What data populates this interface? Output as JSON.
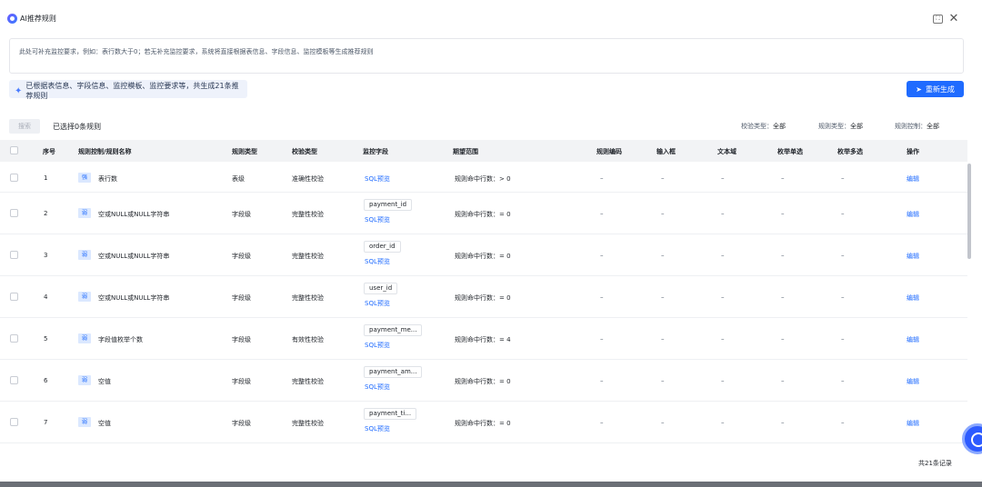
{
  "header": {
    "title": "AI推荐规则",
    "fullscreen_label": "⛶",
    "close_label": "✕"
  },
  "requirement": {
    "placeholder": "此处可补充监控要求，例如：表行数大于0；若无补充监控要求，系统将直接根据表信息、字段信息、监控模板等生成推荐规则"
  },
  "info": {
    "icon": "sparkle-icon",
    "text": "已根据表信息、字段信息、监控模板、监控要求等，共生成21条推荐规则"
  },
  "regen": {
    "label": "重新生成",
    "icon": "send-icon"
  },
  "toolbar": {
    "search_label": "搜索",
    "selected": "已选择0条规则",
    "filters": [
      {
        "label": "校验类型：",
        "value": "全部"
      },
      {
        "label": "规则类型：",
        "value": "全部"
      },
      {
        "label": "规则控制：",
        "value": "全部"
      }
    ]
  },
  "columns": [
    "序号",
    "规则控制/规则名称",
    "规则类型",
    "校验类型",
    "监控字段",
    "期望范围",
    "规则编码",
    "输入框",
    "文本域",
    "枚举单选",
    "枚举多选",
    "操作"
  ],
  "rows": [
    {
      "idx": "1",
      "badge": "强",
      "name": "表行数",
      "rule_type": "表级",
      "check_type": "准确性校验",
      "field": "",
      "sql": "SQL预览",
      "expect": "规则命中行数：> 0",
      "code": "–",
      "input": "–",
      "text": "–",
      "single": "–",
      "multi": "–",
      "op": "编辑"
    },
    {
      "idx": "2",
      "badge": "弱",
      "name": "空或NULL或NULL字符串",
      "rule_type": "字段级",
      "check_type": "完整性校验",
      "field": "payment_id",
      "sql": "SQL预览",
      "expect": "规则命中行数：= 0",
      "code": "–",
      "input": "–",
      "text": "–",
      "single": "–",
      "multi": "–",
      "op": "编辑"
    },
    {
      "idx": "3",
      "badge": "弱",
      "name": "空或NULL或NULL字符串",
      "rule_type": "字段级",
      "check_type": "完整性校验",
      "field": "order_id",
      "sql": "SQL预览",
      "expect": "规则命中行数：= 0",
      "code": "–",
      "input": "–",
      "text": "–",
      "single": "–",
      "multi": "–",
      "op": "编辑"
    },
    {
      "idx": "4",
      "badge": "弱",
      "name": "空或NULL或NULL字符串",
      "rule_type": "字段级",
      "check_type": "完整性校验",
      "field": "user_id",
      "sql": "SQL预览",
      "expect": "规则命中行数：= 0",
      "code": "–",
      "input": "–",
      "text": "–",
      "single": "–",
      "multi": "–",
      "op": "编辑"
    },
    {
      "idx": "5",
      "badge": "弱",
      "name": "字段值枚举个数",
      "rule_type": "字段级",
      "check_type": "有效性校验",
      "field": "payment_me...",
      "sql": "SQL预览",
      "expect": "规则命中行数：= 4",
      "code": "–",
      "input": "–",
      "text": "–",
      "single": "–",
      "multi": "–",
      "op": "编辑"
    },
    {
      "idx": "6",
      "badge": "弱",
      "name": "空值",
      "rule_type": "字段级",
      "check_type": "完整性校验",
      "field": "payment_am...",
      "sql": "SQL预览",
      "expect": "规则命中行数：= 0",
      "code": "–",
      "input": "–",
      "text": "–",
      "single": "–",
      "multi": "–",
      "op": "编辑"
    },
    {
      "idx": "7",
      "badge": "弱",
      "name": "空值",
      "rule_type": "字段级",
      "check_type": "完整性校验",
      "field": "payment_ti...",
      "sql": "SQL预览",
      "expect": "规则命中行数：= 0",
      "code": "–",
      "input": "–",
      "text": "–",
      "single": "–",
      "multi": "–",
      "op": "编辑"
    }
  ],
  "footer": {
    "total": "共21条记录"
  },
  "colors": {
    "accent": "#1f6bff",
    "badge_bg": "#dbe8ff",
    "header_bg": "#f2f3f5",
    "info_bg": "#eef2fb"
  }
}
